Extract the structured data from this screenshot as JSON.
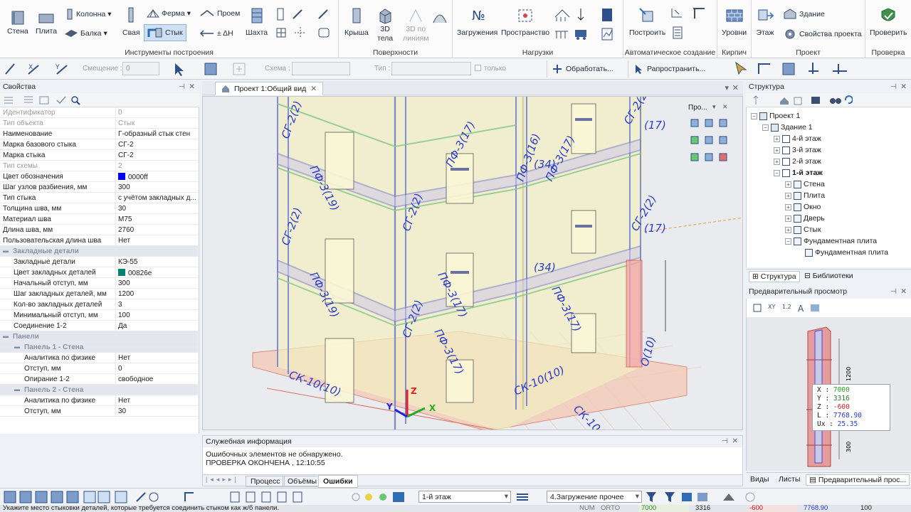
{
  "ribbon": {
    "groups": {
      "build_tools": "Инструменты построения",
      "surfaces": "Поверхности",
      "loads": "Нагрузки",
      "auto_create": "Автоматическое создание",
      "brick": "Кирпич",
      "project": "Проект",
      "check": "Проверка"
    },
    "buttons": {
      "wall": "Стена",
      "slab": "Плита",
      "column": "Колонна",
      "beam": "Балка",
      "pile": "Свая",
      "truss": "Ферма",
      "joint": "Стык",
      "opening": "Проем",
      "delta_h": "± ΔН",
      "shaft": "Шахта",
      "roof": "Крыша",
      "body3d_a": "3D",
      "body3d_b": "тела",
      "line3d_a": "3D по",
      "line3d_b": "линиям",
      "loadings": "Загружения",
      "spaces": "Пространство",
      "build": "Построить",
      "levels": "Уровни",
      "floor": "Этаж",
      "building": "Здание",
      "project_props": "Свойства проекта",
      "verify": "Проверить"
    }
  },
  "toolbar2": {
    "offset_label": "Смещение :",
    "offset_value": "0",
    "scheme_label": "Схема :",
    "type_label": "Тип :",
    "only_label": "только",
    "process_btn": "Обработать...",
    "spread_btn": "Рапространить..."
  },
  "props": {
    "title": "Свойства",
    "rows": [
      {
        "k": "Идентификатор",
        "v": "0",
        "style": "grey"
      },
      {
        "k": "Тип объекта",
        "v": "Стык",
        "style": "grey"
      },
      {
        "k": "Наименование",
        "v": "Г-образный стык стен",
        "style": ""
      },
      {
        "k": "Марка базового стыка",
        "v": "СГ-2",
        "style": ""
      },
      {
        "k": "Марка стыка",
        "v": "СГ-2",
        "style": ""
      },
      {
        "k": "Тип схемы",
        "v": "2",
        "style": "grey"
      },
      {
        "k": "Цвет обозначения",
        "v": "0000ff",
        "style": "",
        "color": "#0000ff"
      },
      {
        "k": "Шаг узлов разбиения, мм",
        "v": "300",
        "style": ""
      },
      {
        "k": "Тип стыка",
        "v": "с учётом закладных д...",
        "style": ""
      },
      {
        "k": "Толщина шва, мм",
        "v": "30",
        "style": ""
      },
      {
        "k": "Материал шва",
        "v": "М75",
        "style": ""
      },
      {
        "k": "Длина шва, мм",
        "v": "2760",
        "style": ""
      },
      {
        "k": "Пользовательская длина шва",
        "v": "Нет",
        "style": ""
      },
      {
        "k": "Закладные детали",
        "v": "",
        "style": "sec",
        "indent": 0
      },
      {
        "k": "Закладные детали",
        "v": "КЭ-55",
        "style": "",
        "indent": 1
      },
      {
        "k": "Цвет закладных деталей",
        "v": "00826e",
        "style": "",
        "indent": 1,
        "color": "#00826e"
      },
      {
        "k": "Начальный отступ, мм",
        "v": "300",
        "style": "",
        "indent": 1
      },
      {
        "k": "Шаг закладных деталей, мм",
        "v": "1200",
        "style": "",
        "indent": 1
      },
      {
        "k": "Кол-во закладных деталей",
        "v": "3",
        "style": "",
        "indent": 1
      },
      {
        "k": "Минимальный отступ, мм",
        "v": "100",
        "style": "",
        "indent": 1
      },
      {
        "k": "Соединение 1-2",
        "v": "Да",
        "style": "",
        "indent": 1
      },
      {
        "k": "Панели",
        "v": "",
        "style": "sec",
        "indent": 0
      },
      {
        "k": "Панель 1 - Стена",
        "v": "",
        "style": "sec",
        "indent": 1
      },
      {
        "k": "Аналитика по физике",
        "v": "Нет",
        "style": "",
        "indent": 2
      },
      {
        "k": "Отступ, мм",
        "v": "0",
        "style": "",
        "indent": 2
      },
      {
        "k": "Опирание 1-2",
        "v": "свободное",
        "style": "",
        "indent": 2
      },
      {
        "k": "Панель 2 - Стена",
        "v": "",
        "style": "sec",
        "indent": 1
      },
      {
        "k": "Аналитика по физике",
        "v": "Нет",
        "style": "",
        "indent": 2
      },
      {
        "k": "Отступ, мм",
        "v": "30",
        "style": "",
        "indent": 2
      }
    ]
  },
  "viewport": {
    "tab_title": "Проект 1:Общий вид",
    "mini_panel_title": "Про...",
    "labels": {
      "sg": "СГ-2(2)",
      "pf17": "ПФ-3(17)",
      "pf19": "ПФ-3(19)",
      "pf34": "(34)",
      "pf16": "ПФ-3(16)",
      "sk10": "СК-10(10)",
      "o10": "О(10)",
      "n17": "(17)"
    },
    "axes": {
      "z": "Z",
      "y": "Y",
      "x": "X"
    }
  },
  "service": {
    "title": "Служебная информация",
    "lines": [
      "Ошибочных элементов не обнаружено.",
      "ПРОВЕРКА ОКОНЧЕНА , 12:10:55"
    ],
    "tabs": [
      "Процесс",
      "Объёмы",
      "Ошибки"
    ]
  },
  "structure": {
    "title": "Структура",
    "items": [
      {
        "label": "Проект 1",
        "level": 0,
        "bold": false,
        "exp": "−"
      },
      {
        "label": "Здание 1",
        "level": 1,
        "bold": false,
        "exp": "−"
      },
      {
        "label": "4-й этаж",
        "level": 2,
        "bold": false,
        "exp": "+"
      },
      {
        "label": "3-й этаж",
        "level": 2,
        "bold": false,
        "exp": "+"
      },
      {
        "label": "2-й этаж",
        "level": 2,
        "bold": false,
        "exp": "+"
      },
      {
        "label": "1-й этаж",
        "level": 2,
        "bold": true,
        "exp": "−"
      },
      {
        "label": "Стена",
        "level": 3,
        "bold": false,
        "exp": "+"
      },
      {
        "label": "Плита",
        "level": 3,
        "bold": false,
        "exp": "+"
      },
      {
        "label": "Окно",
        "level": 3,
        "bold": false,
        "exp": "+"
      },
      {
        "label": "Дверь",
        "level": 3,
        "bold": false,
        "exp": "+"
      },
      {
        "label": "Стык",
        "level": 3,
        "bold": false,
        "exp": "+"
      },
      {
        "label": "Фундаментная плита",
        "level": 3,
        "bold": false,
        "exp": "−"
      },
      {
        "label": "Фундаментная плита",
        "level": 4,
        "bold": false,
        "exp": ""
      }
    ],
    "tab_structure": "Структура",
    "tab_libraries": "Библиотеки"
  },
  "preview": {
    "title": "Предварительный просмотр",
    "coords": {
      "x_label": "X :",
      "x": "7000",
      "y_label": "Y :",
      "y": "3316",
      "z_label": "Z :",
      "z": "-600",
      "l_label": "L :",
      "l": "7768.90",
      "ux_label": "Ux :",
      "ux": "25.35"
    },
    "dim_top": "1200",
    "dim_bottom": "300",
    "tabs": [
      "Виды",
      "Листы",
      "Предварительный прос..."
    ]
  },
  "statusbar2": {
    "floor": "1-й этаж",
    "loading": "4.Загружение прочее"
  },
  "statusbar": {
    "hint": "Укажите место стыковки деталей, которые требуется соединить стыком как ж/б панели.",
    "num": "NUM",
    "orto": "ORTO",
    "x": "7000",
    "y": "3316",
    "z": "-600",
    "l": "7768.90",
    "last": "100"
  },
  "colors": {
    "accent": "#2d6db5",
    "joint": "#0000ff",
    "embed": "#00826e"
  }
}
